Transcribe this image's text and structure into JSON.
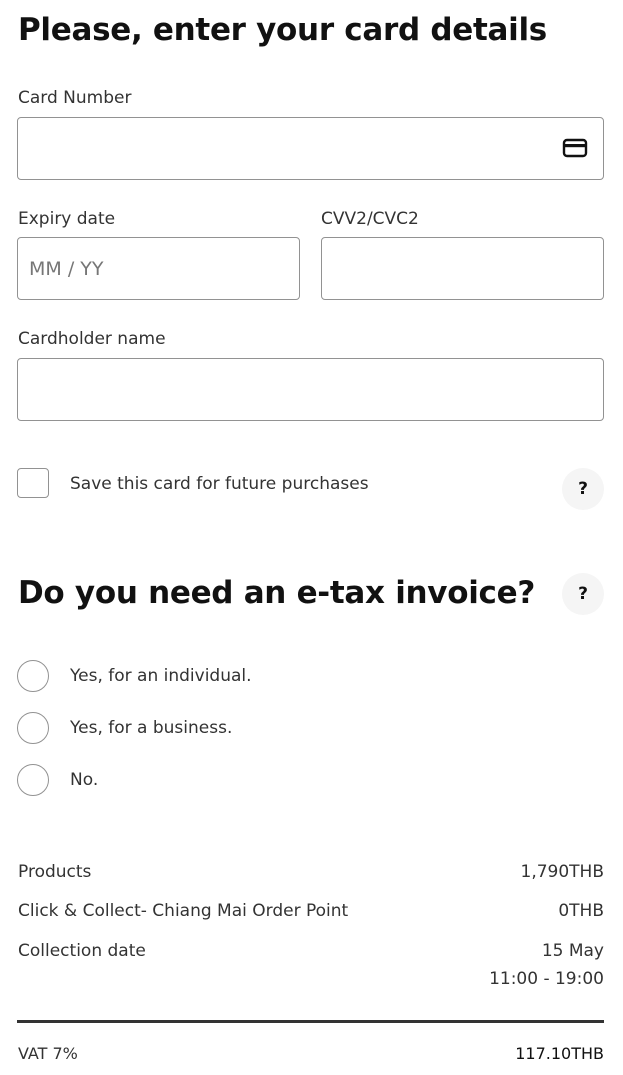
{
  "card_form": {
    "title": "Please, enter your card details",
    "card_number": {
      "label": "Card Number",
      "value": "",
      "placeholder": ""
    },
    "expiry": {
      "label": "Expiry date",
      "value": "",
      "placeholder": "MM / YY"
    },
    "cvv": {
      "label": "CVV2/CVC2",
      "value": "",
      "placeholder": ""
    },
    "cardholder": {
      "label": "Cardholder name",
      "value": "",
      "placeholder": ""
    },
    "save_card": {
      "label": "Save this card for future purchases",
      "checked": false
    },
    "help_label": "?"
  },
  "etax": {
    "title": "Do you need an e-tax invoice?",
    "help_label": "?",
    "options": [
      {
        "label": "Yes, for an individual."
      },
      {
        "label": "Yes, for a business."
      },
      {
        "label": "No."
      }
    ]
  },
  "summary": {
    "products": {
      "label": "Products",
      "value": "1,790THB"
    },
    "click_collect": {
      "label": "Click & Collect- Chiang Mai Order Point",
      "value": "0THB"
    },
    "collection_date": {
      "label": "Collection date",
      "date": "15 May",
      "time": "11:00 - 19:00"
    },
    "vat": {
      "label": "VAT 7%",
      "value": "117.10THB"
    }
  },
  "icons": {
    "card_icon": "credit-card-icon"
  },
  "colors": {
    "border": "#929292",
    "text": "#111111",
    "help_bg": "#f5f5f5"
  }
}
